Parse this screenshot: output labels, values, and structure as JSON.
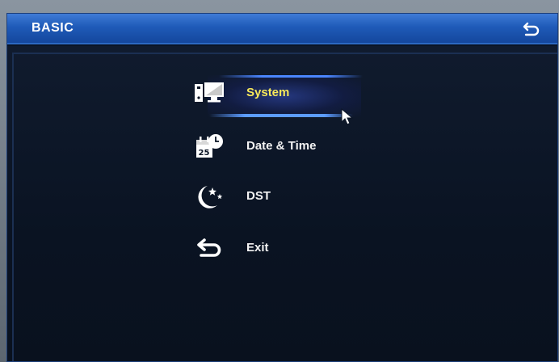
{
  "window": {
    "title": "BASIC"
  },
  "menu": {
    "items": [
      {
        "label": "System",
        "icon": "computer-monitor-icon",
        "selected": true
      },
      {
        "label": "Date & Time",
        "icon": "calendar-clock-icon",
        "selected": false
      },
      {
        "label": "DST",
        "icon": "moon-stars-icon",
        "selected": false
      },
      {
        "label": "Exit",
        "icon": "return-arrow-icon",
        "selected": false
      }
    ]
  },
  "colors": {
    "titlebar": "#1f5ab8",
    "background": "#0b1526",
    "selected_text": "#f6e85a",
    "text": "#f2f2f2"
  }
}
